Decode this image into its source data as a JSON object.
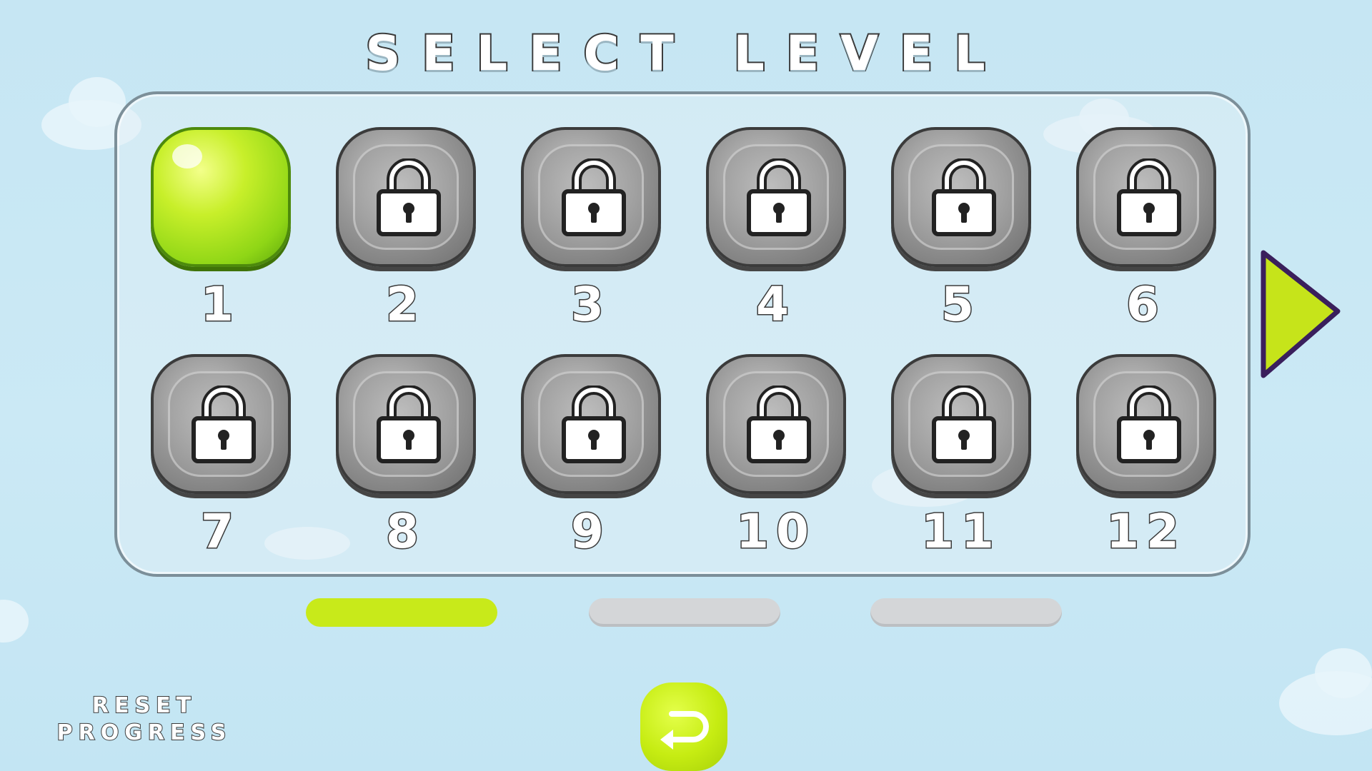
{
  "screen": {
    "title": "SELECT LEVEL"
  },
  "levels": [
    {
      "number": "1",
      "locked": false
    },
    {
      "number": "2",
      "locked": true
    },
    {
      "number": "3",
      "locked": true
    },
    {
      "number": "4",
      "locked": true
    },
    {
      "number": "5",
      "locked": true
    },
    {
      "number": "6",
      "locked": true
    },
    {
      "number": "7",
      "locked": true
    },
    {
      "number": "8",
      "locked": true
    },
    {
      "number": "9",
      "locked": true
    },
    {
      "number": "10",
      "locked": true
    },
    {
      "number": "11",
      "locked": true
    },
    {
      "number": "12",
      "locked": true
    }
  ],
  "pagination": {
    "current_page": 1,
    "total_pages": 3
  },
  "controls": {
    "reset_label_line1": "RESET",
    "reset_label_line2": "PROGRESS",
    "next_icon": "play-arrow-icon",
    "back_icon": "return-arrow-icon"
  },
  "colors": {
    "accent_green": "#c8ea1a",
    "tile_gray": "#9a9a9a",
    "background_sky": "#c8e8f4",
    "arrow_outline": "#3a1f5c"
  }
}
